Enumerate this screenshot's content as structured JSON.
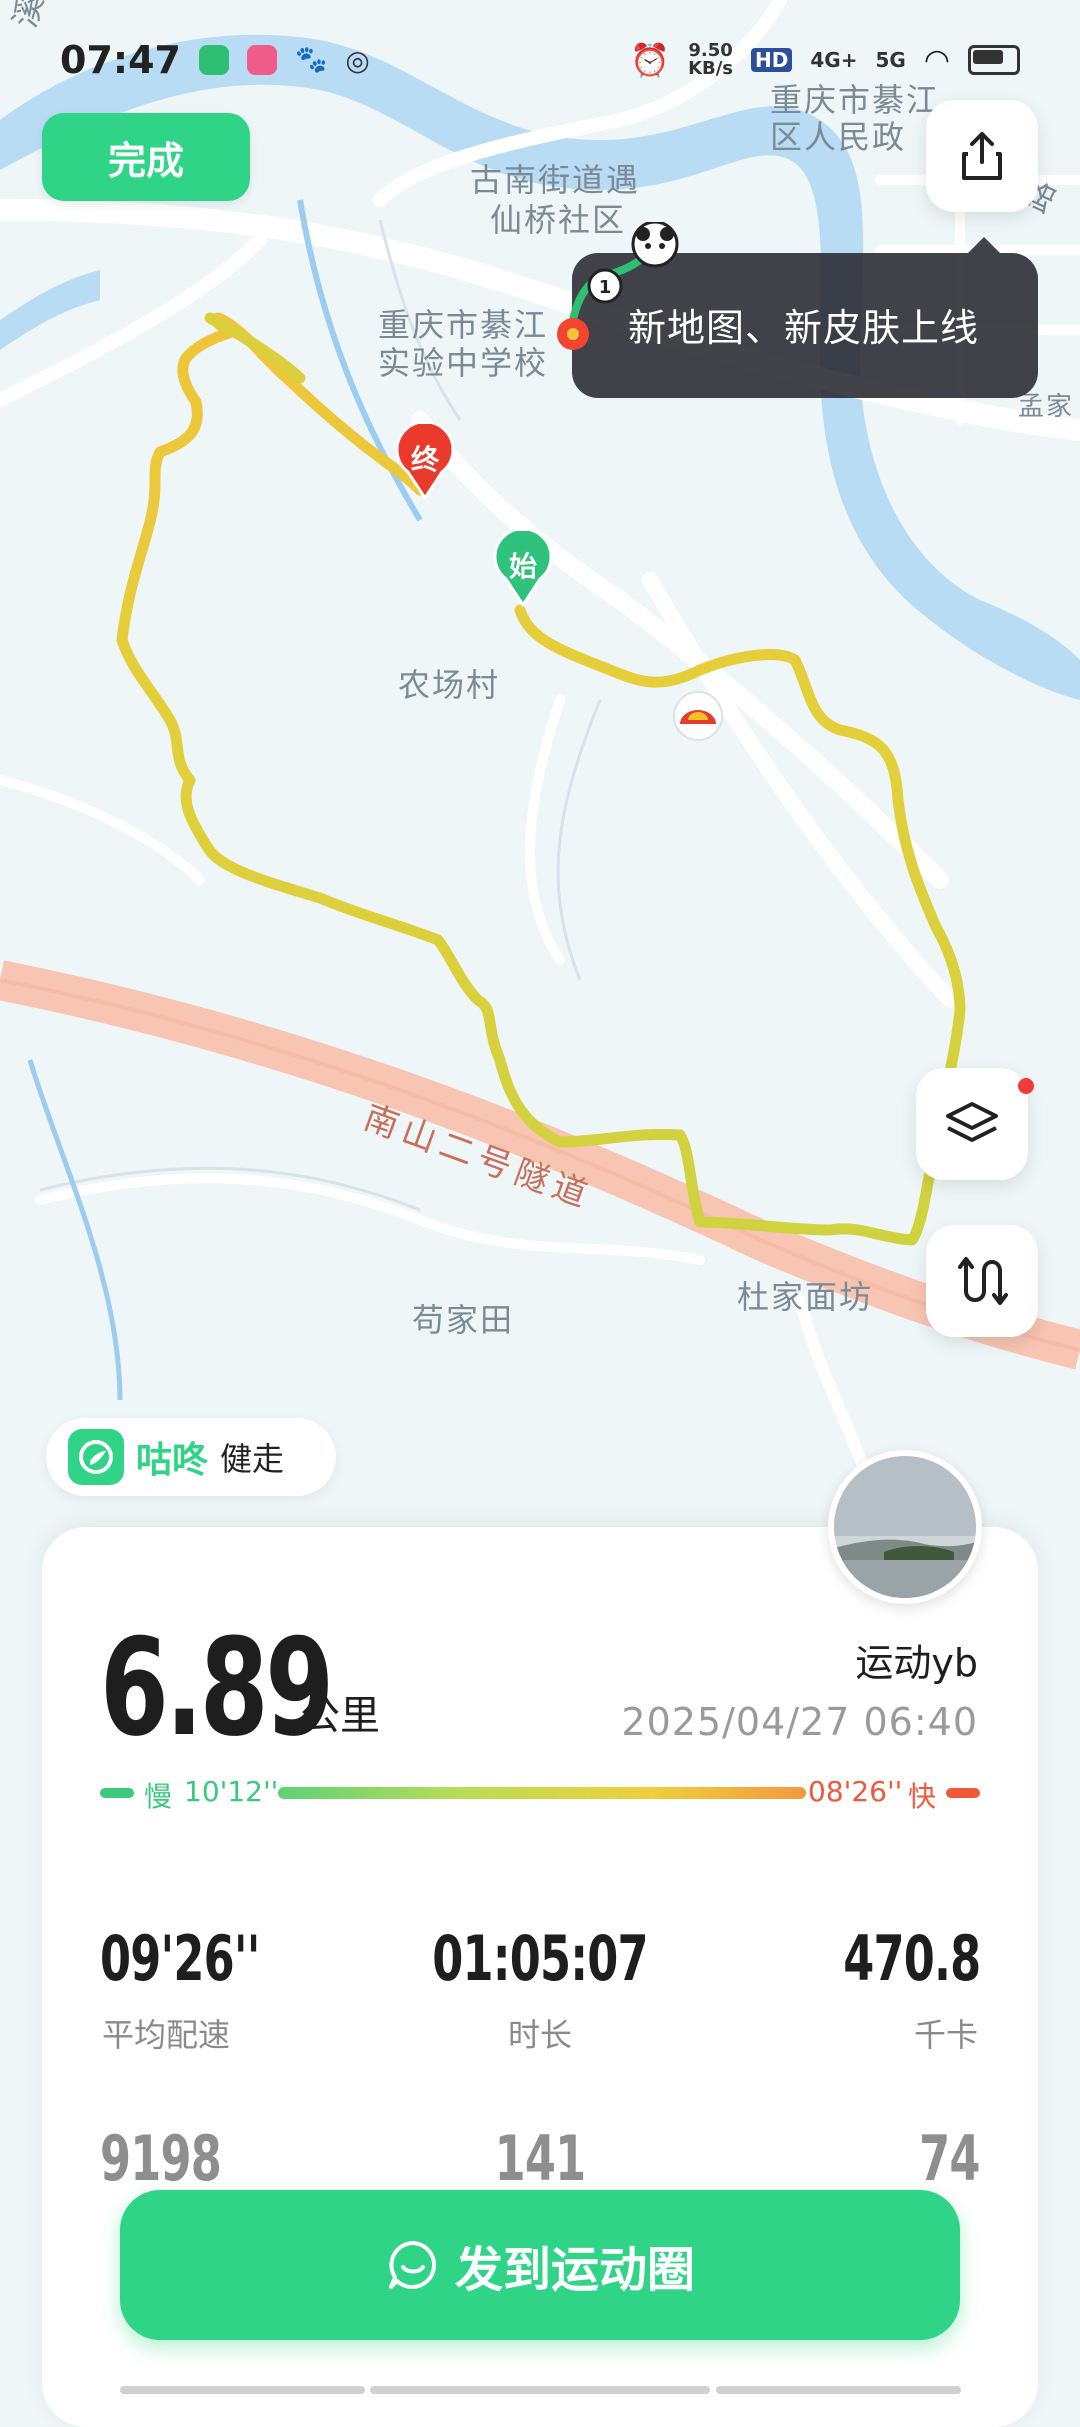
{
  "status_bar": {
    "time": "07:47",
    "net_speed": "9.50",
    "net_unit": "KB/s",
    "hd": "HD",
    "sig1": "4G+",
    "sig2": "5G"
  },
  "map": {
    "labels": {
      "top_left": "溪路",
      "gov": "重庆市綦江",
      "gov2": "区人民政",
      "jiedao": "古南街道遇",
      "shequ": "仙桥社区",
      "school": "重庆市綦江",
      "school2": "实验中学校",
      "nongchang": "农场村",
      "road": "南山二号隧道",
      "shaojiatian": "苟家田",
      "dujia": "杜家面坊",
      "mengjia": "孟家",
      "lu": "路"
    },
    "marker_end": "终",
    "marker_start": "始"
  },
  "done_button": "完成",
  "tooltip": "新地图、新皮肤上线",
  "brand": {
    "name": "咕咚",
    "activity": "健走"
  },
  "summary": {
    "distance": "6.89",
    "distance_unit": "公里",
    "username": "运动yb",
    "datetime": "2025/04/27 06:40",
    "pace_slow_label": "慢",
    "pace_slow_value": "10'12''",
    "pace_fast_value": "08'26''",
    "pace_fast_label": "快"
  },
  "stats": [
    {
      "value": "09'26''",
      "label": "平均配速"
    },
    {
      "value": "01:05:07",
      "label": "时长"
    },
    {
      "value": "470.8",
      "label": "千卡"
    },
    {
      "value": "9198",
      "label": ""
    },
    {
      "value": "141",
      "label": ""
    },
    {
      "value": "74",
      "label": ""
    }
  ],
  "post_button": "发到运动圈",
  "colors": {
    "accent": "#2fd487",
    "fast": "#f0583c",
    "slow": "#3cc97e"
  }
}
